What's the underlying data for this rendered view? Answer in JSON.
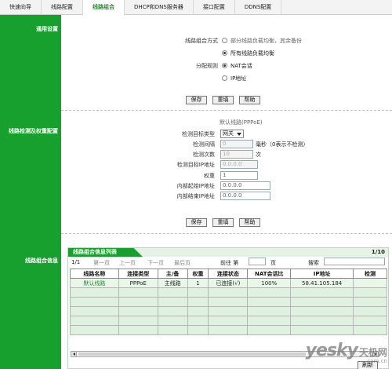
{
  "tabs": [
    "快速向导",
    "线路配置",
    "线路组合",
    "DHCP和DNS服务器",
    "接口配置",
    "DDNS配置"
  ],
  "active_tab": 2,
  "sidebar": {
    "general": "通用设置",
    "detect": "线路检测及权重配置",
    "info": "线路组合信息"
  },
  "general": {
    "mode_label": "线路组合方式",
    "mode_opt1": "部分线路负载均衡，其余备份",
    "mode_opt2": "所有线路负载均衡",
    "alloc_label": "分配规则",
    "alloc_opt1": "NAT会话",
    "alloc_opt2": "IP地址",
    "save": "保存",
    "reset": "重填",
    "help": "帮助"
  },
  "detect": {
    "line_name": "默认线路(PPPoE)",
    "target_type_label": "检测目标类型",
    "target_type_value": "网关",
    "interval_label": "检测间隔",
    "interval_value": "0",
    "interval_unit": "毫秒（0表示不检测）",
    "count_label": "检测次数",
    "count_value": "10",
    "count_unit": "次",
    "target_ip_label": "检测目标IP地址",
    "target_ip_value": "0.0.0.0",
    "weight_label": "权重",
    "weight_value": "1",
    "start_ip_label": "内部起始IP地址",
    "start_ip_value": "0.0.0.0",
    "end_ip_label": "内部结束IP地址",
    "end_ip_value": "0.0.0.0",
    "save": "保存",
    "reset": "重填",
    "help": "帮助"
  },
  "table": {
    "title": "线路组合信息列表",
    "page_count": "1/10",
    "page_info": "1/1",
    "first": "第一页",
    "prev": "上一页",
    "next": "下一页",
    "last": "最后页",
    "goto_prefix": "前往 第",
    "goto_suffix": "页",
    "search_label": "搜索",
    "refresh": "刷新",
    "columns": [
      "线路名称",
      "连接类型",
      "主/备",
      "权重",
      "连接状态",
      "NAT会话比",
      "IP地址",
      "检测"
    ],
    "rows": [
      [
        "默认线路",
        "PPPoE",
        "主线路",
        "1",
        "已连接(√)",
        "100%",
        "58.41.105.184",
        ""
      ]
    ],
    "empty_rows": 5
  },
  "watermark": {
    "big": "yesky",
    "cn": "天极网",
    "url": "com.cn"
  }
}
